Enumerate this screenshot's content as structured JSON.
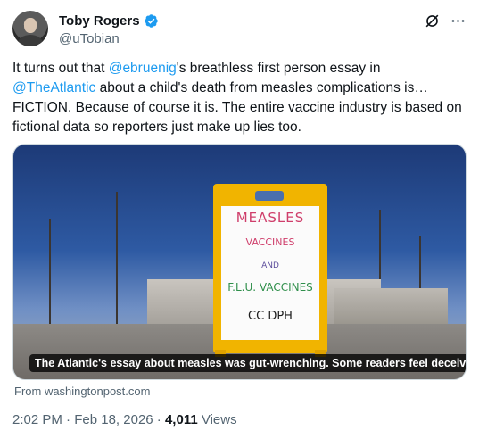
{
  "author": {
    "name": "Toby Rogers",
    "handle": "@uTobian"
  },
  "tweet": {
    "pre_mention": "It turns out that ",
    "mention_1": "@ebruenig",
    "mid_1": "'s breathless first person essay in ",
    "mention_2": "@TheAtlantic",
    "rest": " about a child's death from measles complications is… FICTION. Because of course it is. The entire vaccine industry is based on fictional data so reporters just make up lies too."
  },
  "media": {
    "sign_lines": [
      "MEASLES",
      "VACCINES",
      "AND",
      "F.L.U. VACCINES",
      "CC DPH"
    ],
    "caption": "The Atlantic's essay about measles was gut-wrenching. Some readers feel deceived."
  },
  "source": "From washingtonpost.com",
  "meta": {
    "time": "2:02 PM",
    "date": "Feb 18, 2026",
    "separator": "·",
    "views_count": "4,011",
    "views_label": "Views"
  },
  "colors": {
    "accent": "#1d9bf0",
    "secondary_text": "#536471"
  },
  "icons": [
    "verified-badge-icon",
    "grok-icon",
    "more-icon"
  ]
}
